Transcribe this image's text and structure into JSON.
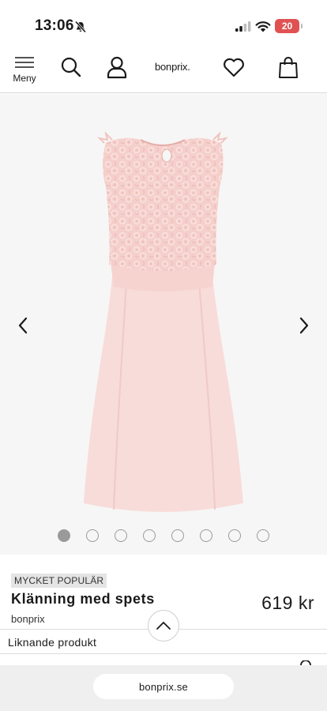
{
  "status_bar": {
    "time": "13:06",
    "battery_level": "20",
    "icons": [
      "mute-icon",
      "signal-icon",
      "wifi-icon",
      "battery-icon"
    ]
  },
  "header": {
    "menu_label": "Meny",
    "logo_text": "bonprix.",
    "icons": [
      "menu-icon",
      "search-icon",
      "account-icon",
      "heart-icon",
      "shopping-bag-icon"
    ]
  },
  "gallery": {
    "image": "pink-lace-dress",
    "image_count": 8,
    "active_index": 1,
    "colors": {
      "dress": "#f7d9d6",
      "background": "#f6f6f6"
    }
  },
  "product": {
    "badge": "MYCKET POPULÄR",
    "name": "Klänning med spets",
    "price": "619 kr",
    "brand": "bonprix"
  },
  "similar": {
    "label": "Liknande produkt"
  },
  "browser": {
    "url": "bonprix.se"
  }
}
